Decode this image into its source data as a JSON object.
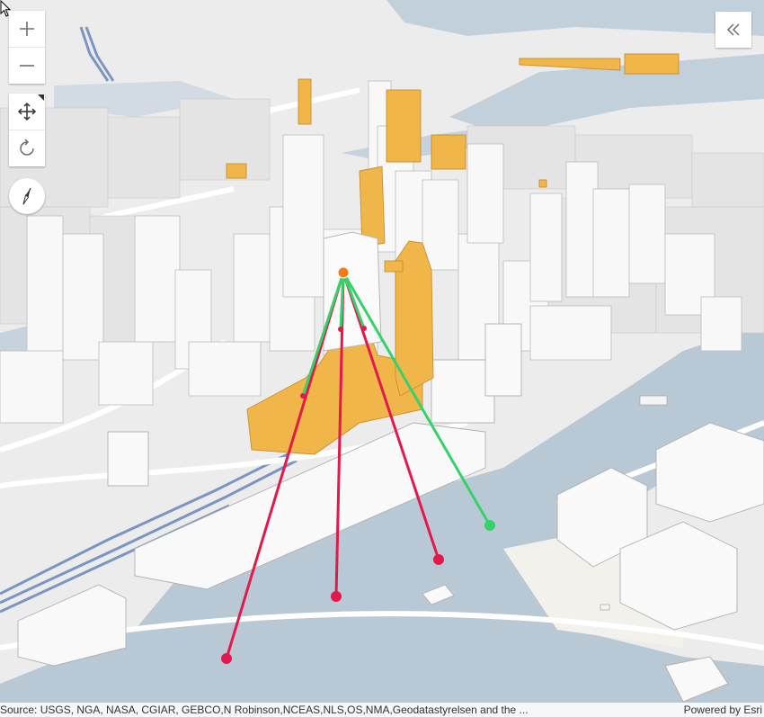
{
  "controls": {
    "zoom_in_icon": "plus-icon",
    "zoom_out_icon": "minus-icon",
    "pan_icon": "pan-arrows-icon",
    "rotate_icon": "rotate-icon",
    "compass_icon": "compass-icon",
    "expand_icon": "double-chevron-left-icon"
  },
  "attribution": {
    "source": "Source: USGS, NGA, NASA, CGIAR, GEBCO,N Robinson,NCEAS,NLS,OS,NMA,Geodatastyrelsen and the ...",
    "powered": "Powered by Esri"
  },
  "colors": {
    "water": "#b8c7d6",
    "land": "#eeeeee",
    "building": "#f7f7f7",
    "highlight_building": "#f0b64a",
    "sight_visible": "#36d16b",
    "sight_blocked": "#e3194b",
    "observer": "#f07d1a",
    "rail": "#6f8fbf"
  }
}
